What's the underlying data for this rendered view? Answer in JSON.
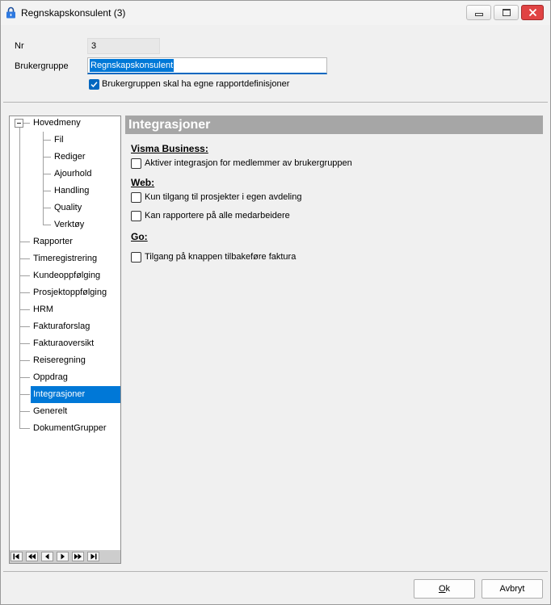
{
  "window": {
    "title": "Regnskapskonsulent (3)",
    "title_icon": "lock-icon",
    "controls": {
      "minimize_icon": "minimize-icon",
      "maximize_icon": "maximize-icon",
      "close_icon": "close-icon"
    }
  },
  "form": {
    "nr": {
      "label": "Nr",
      "value": "3"
    },
    "group": {
      "label": "Brukergruppe",
      "value": "Regnskapskonsulent"
    },
    "own_reports": {
      "label": "Brukergruppen skal ha egne rapportdefinisjoner",
      "checked": true
    }
  },
  "tree": {
    "root": {
      "label": "Hovedmeny",
      "expanded": true,
      "expander_icon": "collapse-minus-icon",
      "children": [
        {
          "label": "Fil"
        },
        {
          "label": "Rediger"
        },
        {
          "label": "Ajourhold"
        },
        {
          "label": "Handling"
        },
        {
          "label": "Quality"
        },
        {
          "label": "Verktøy"
        }
      ]
    },
    "items": [
      {
        "label": "Rapporter"
      },
      {
        "label": "Timeregistrering"
      },
      {
        "label": "Kundeoppfølging"
      },
      {
        "label": "Prosjektoppfølging"
      },
      {
        "label": "HRM"
      },
      {
        "label": "Fakturaforslag"
      },
      {
        "label": "Fakturaoversikt"
      },
      {
        "label": "Reiseregning"
      },
      {
        "label": "Oppdrag"
      },
      {
        "label": "Integrasjoner",
        "selected": true
      },
      {
        "label": "Generelt"
      },
      {
        "label": "DokumentGrupper"
      }
    ]
  },
  "navigator": {
    "buttons": [
      "first-record-icon",
      "previous-page-icon",
      "previous-record-icon",
      "next-record-icon",
      "next-page-icon",
      "last-record-icon"
    ]
  },
  "panel": {
    "title": "Integrasjoner",
    "sections": [
      {
        "heading": "Visma Business:",
        "options": [
          {
            "label": "Aktiver integrasjon for medlemmer av brukergruppen",
            "checked": false
          }
        ]
      },
      {
        "heading": "Web:",
        "options": [
          {
            "label": "Kun tilgang til prosjekter i egen avdeling",
            "checked": false
          },
          {
            "label": "Kan rapportere på alle medarbeidere",
            "checked": false
          }
        ]
      },
      {
        "heading": "Go:",
        "options": [
          {
            "label": "Tilgang på knappen tilbakeføre faktura",
            "checked": false
          }
        ]
      }
    ]
  },
  "footer": {
    "ok_label": "Ok",
    "cancel_label": "Avbryt"
  },
  "colors": {
    "selection": "#0078d7",
    "checkbox_checked": "#0067c0",
    "panel_header": "#a6a6a6",
    "close_button": "#e04343",
    "window_bg": "#f0f0f0"
  }
}
